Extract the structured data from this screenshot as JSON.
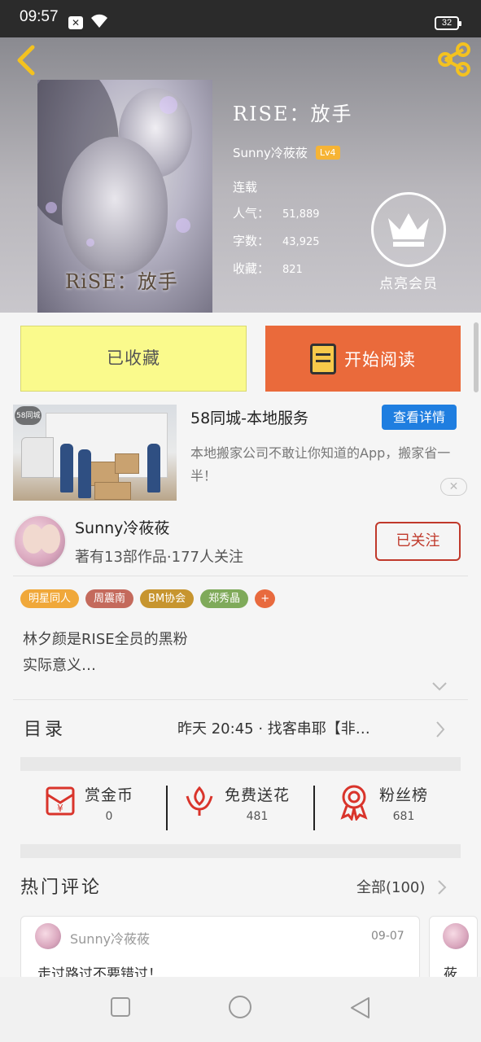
{
  "status_bar": {
    "time": "09:57",
    "battery": "32"
  },
  "book": {
    "title": "RISE：放手",
    "cover_title": "RiSE：放手",
    "author": "Sunny冷莜莜",
    "level": "Lv4",
    "status": "连载",
    "popularity_label": "人气：",
    "popularity": "51,889",
    "words_label": "字数：",
    "words": "43,925",
    "favorites_label": "收藏：",
    "favorites": "821"
  },
  "vip": {
    "label": "点亮会员"
  },
  "actions": {
    "collected": "已收藏",
    "start_reading": "开始阅读"
  },
  "ad": {
    "image_tag": "58同城",
    "title": "58同城-本地服务",
    "button": "查看详情",
    "description": "本地搬家公司不敢让你知道的App，搬家省一半！"
  },
  "author_card": {
    "name": "Sunny冷莜莜",
    "stats": "著有13部作品·177人关注",
    "follow_button": "已关注"
  },
  "tags": [
    {
      "label": "明星同人",
      "color": "#f0a83a"
    },
    {
      "label": "周震南",
      "color": "#c46a5c"
    },
    {
      "label": "BM协会",
      "color": "#c7952f"
    },
    {
      "label": "郑秀晶",
      "color": "#7faa5a"
    },
    {
      "label": "+",
      "color": "#e86a3e"
    }
  ],
  "description": [
    "林夕颜是RISE全员的黑粉",
    "实际意义…"
  ],
  "toc": {
    "label": "目录",
    "latest": "昨天 20:45 · 找客串耶【非…"
  },
  "stats": [
    {
      "label": "赏金币",
      "value": "0"
    },
    {
      "label": "免费送花",
      "value": "481"
    },
    {
      "label": "粉丝榜",
      "value": "681"
    }
  ],
  "comments_section": {
    "title": "热门评论",
    "all": "全部(100)"
  },
  "comments": [
    {
      "author": "Sunny冷莜莜",
      "date": "09-07",
      "text": "走过路过不要错过！"
    },
    {
      "text": "莜"
    }
  ]
}
